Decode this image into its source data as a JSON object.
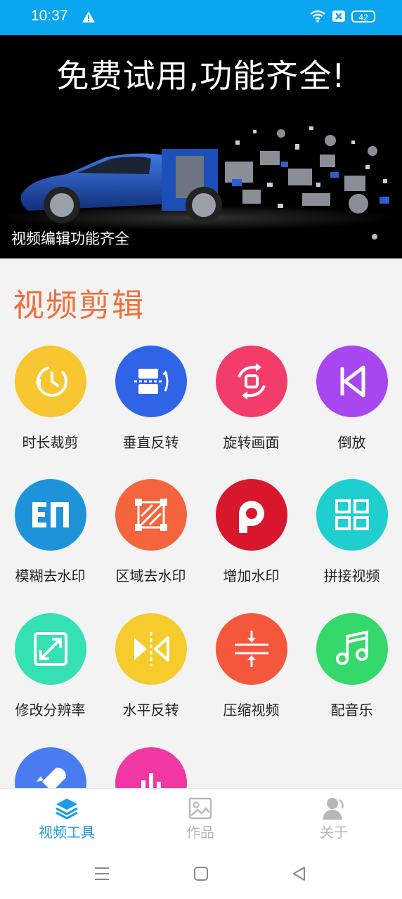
{
  "status": {
    "time": "10:37",
    "battery": "42"
  },
  "banner": {
    "title": "免费试用,功能齐全!",
    "caption": "视频编辑功能齐全"
  },
  "section": {
    "title": "视频剪辑"
  },
  "tools": [
    {
      "label": "时长裁剪",
      "icon": "clock-rewind-icon",
      "color": "#f7c631"
    },
    {
      "label": "垂直反转",
      "icon": "vertical-flip-icon",
      "color": "#2f64e8"
    },
    {
      "label": "旋转画面",
      "icon": "rotate-icon",
      "color": "#f23d6b"
    },
    {
      "label": "倒放",
      "icon": "reverse-play-icon",
      "color": "#a846f0"
    },
    {
      "label": "模糊去水印",
      "icon": "blur-watermark-icon",
      "color": "#1f93d9"
    },
    {
      "label": "区域去水印",
      "icon": "area-watermark-icon",
      "color": "#f5653d"
    },
    {
      "label": "增加水印",
      "icon": "add-watermark-icon",
      "color": "#d8172c"
    },
    {
      "label": "拼接视频",
      "icon": "grid-join-icon",
      "color": "#1fcfcf"
    },
    {
      "label": "修改分辨率",
      "icon": "resize-icon",
      "color": "#35e0b3"
    },
    {
      "label": "水平反转",
      "icon": "horizontal-flip-icon",
      "color": "#f6cc2c"
    },
    {
      "label": "压缩视频",
      "icon": "compress-icon",
      "color": "#f5573d"
    },
    {
      "label": "配音乐",
      "icon": "music-note-icon",
      "color": "#35d86a"
    },
    {
      "label": "",
      "icon": "rocket-icon",
      "color": "#4a7cf1"
    },
    {
      "label": "",
      "icon": "audio-bars-icon",
      "color": "#f037a4"
    }
  ],
  "tabs": [
    {
      "label": "视频工具",
      "icon": "layers-icon",
      "active": true,
      "color": "#1b9be8"
    },
    {
      "label": "作品",
      "icon": "image-icon",
      "active": false,
      "color": "#b8b8b8"
    },
    {
      "label": "关于",
      "icon": "user-icon",
      "active": false,
      "color": "#b8b8b8"
    }
  ]
}
